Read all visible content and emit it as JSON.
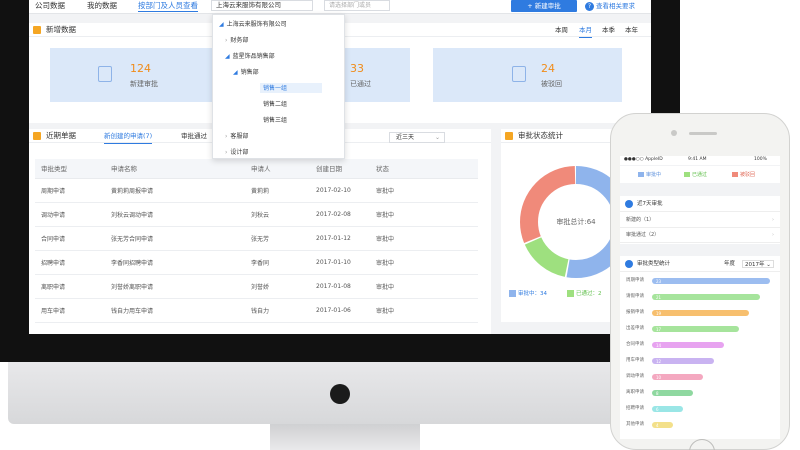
{
  "nav": {
    "company_data": "公司数据",
    "my_data": "我的数据",
    "dept_view": "按部门及人员查看",
    "org_selected": "上海云来服饰有限公司",
    "dept_search_placeholder": "请选择部门或员",
    "new_approval": "+ 新建审批",
    "view_help": "查看相关要求",
    "help_icon": "question-icon"
  },
  "new_data": {
    "title": "新增数据",
    "periods": [
      "本周",
      "本月",
      "本季",
      "本年"
    ],
    "active_period": "本月",
    "cards": [
      {
        "value": "124",
        "label": "新建审批",
        "icon": "document-icon"
      },
      {
        "value": "33",
        "label": "已通过",
        "icon": "check-icon"
      },
      {
        "value": "24",
        "label": "被驳回",
        "icon": "return-icon"
      }
    ]
  },
  "dropdown": {
    "items": [
      {
        "label": "上海云来服饰有限公司",
        "prefix": "◢"
      },
      {
        "label": "财务部",
        "prefix": "›"
      },
      {
        "label": "蓝星饰品销售部",
        "prefix": "◢"
      },
      {
        "label": "销售部",
        "prefix": "◢"
      },
      {
        "label": "销售一组",
        "prefix": ""
      },
      {
        "label": "销售二组",
        "prefix": ""
      },
      {
        "label": "销售三组",
        "prefix": ""
      },
      {
        "label": "客服部",
        "prefix": "›"
      },
      {
        "label": "设计部",
        "prefix": "›"
      }
    ],
    "highlighted": "销售一组"
  },
  "recent": {
    "title": "近期单据",
    "tabs": [
      "新创建的申请(7)",
      "审批通过"
    ],
    "range": "近三天",
    "columns": [
      "审批类型",
      "申请名称",
      "申请人",
      "创建日期",
      "状态"
    ],
    "rows": [
      [
        "周期申请",
        "黄莉莉周报申请",
        "黄莉莉",
        "2017-02-10",
        "审批中"
      ],
      [
        "调动申请",
        "刘秋云调动申请",
        "刘秋云",
        "2017-02-08",
        "审批中"
      ],
      [
        "合同申请",
        "张无芳合同申请",
        "张无芳",
        "2017-01-12",
        "审批中"
      ],
      [
        "招聘申请",
        "李香同招聘申请",
        "李香同",
        "2017-01-10",
        "审批中"
      ],
      [
        "离职申请",
        "刘誉娇离职申请",
        "刘誉娇",
        "2017-01-08",
        "审批中"
      ],
      [
        "用车申请",
        "钱自力用车申请",
        "钱自力",
        "2017-01-06",
        "审批中"
      ]
    ]
  },
  "status_chart": {
    "title": "审批状态统计",
    "center_label": "审批总计:64",
    "legend": [
      "审批中：34",
      "已通过：2"
    ],
    "more_marker": "2"
  },
  "chart_data": {
    "type": "pie",
    "title": "审批状态统计",
    "categories": [
      "审批中",
      "已通过",
      "被驳回"
    ],
    "values": [
      34,
      10,
      20
    ],
    "colors": [
      "#8fb4ec",
      "#9ee07f",
      "#f08a7a"
    ]
  },
  "phone": {
    "status_carrier": "●●●○○ AppleID",
    "status_time": "9:41 AM",
    "status_battery": "100%",
    "legend": [
      {
        "label": "审批中",
        "color": "#8fb4ec"
      },
      {
        "label": "已通过",
        "color": "#9ee07f"
      },
      {
        "label": "被驳回",
        "color": "#f08a7a"
      }
    ],
    "recent_title": "近7天审批",
    "recent_rows": [
      "新建的（1）",
      "审批通过（2）"
    ],
    "type_title": "审批类型统计",
    "type_scope": "年度",
    "type_year": "2017年",
    "bars": [
      {
        "label": "周期申请",
        "value": 23,
        "color": "#9cbdf0"
      },
      {
        "label": "请假申请",
        "value": 21,
        "color": "#a6e49c"
      },
      {
        "label": "报销申请",
        "value": 19,
        "color": "#f7bf6e"
      },
      {
        "label": "出差申请",
        "value": 17,
        "color": "#a6e49c"
      },
      {
        "label": "合同申请",
        "value": 14,
        "color": "#e7a3f0"
      },
      {
        "label": "用车申请",
        "value": 12,
        "color": "#c9b3f1"
      },
      {
        "label": "调动申请",
        "value": 10,
        "color": "#f4a8c0"
      },
      {
        "label": "离职申请",
        "value": 8,
        "color": "#8fd8a0"
      },
      {
        "label": "招聘申请",
        "value": 6,
        "color": "#9ae6e6"
      },
      {
        "label": "其他申请",
        "value": 4,
        "color": "#f3e08a"
      }
    ]
  }
}
